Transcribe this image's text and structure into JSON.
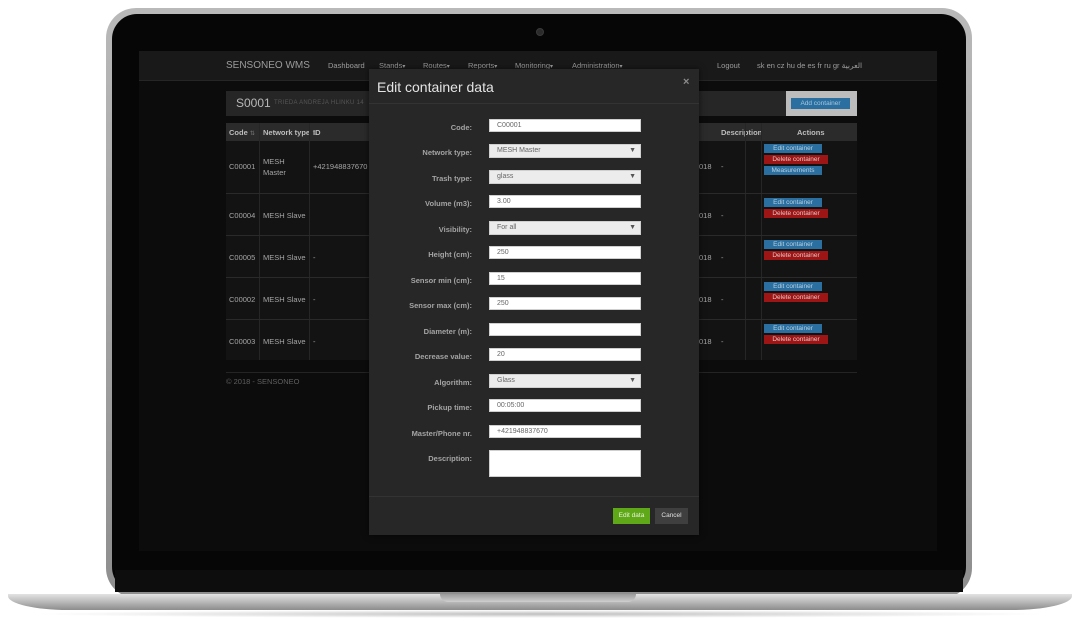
{
  "app": {
    "brand": "SENSONEO WMS"
  },
  "nav": {
    "items": [
      "Dashboard",
      "Stands",
      "Routes",
      "Reports",
      "Monitoring",
      "Administration"
    ],
    "logout": "Logout",
    "languages": "sk en cz hu de es fr ru gr العربية"
  },
  "station": {
    "code": "S0001",
    "address": "TRIEDA ANDREJA HLINKU 14"
  },
  "add_container": "Add container",
  "table": {
    "headers": {
      "code": "Code",
      "network_type": "Network type",
      "id": "ID",
      "description": "Description",
      "actions": "Actions"
    },
    "rows": [
      {
        "code": "C00001",
        "network": "MESH Master",
        "id": "+421948837670",
        "date": "018",
        "description": "-"
      },
      {
        "code": "C00004",
        "network": "MESH Slave",
        "id": "",
        "date": "018",
        "description": "-"
      },
      {
        "code": "C00005",
        "network": "MESH Slave",
        "id": "-",
        "date": "018",
        "description": "-"
      },
      {
        "code": "C00002",
        "network": "MESH Slave",
        "id": "-",
        "date": "018",
        "description": "-"
      },
      {
        "code": "C00003",
        "network": "MESH Slave",
        "id": "-",
        "date": "018",
        "description": "-"
      }
    ],
    "actions": {
      "edit": "Edit container",
      "delete": "Delete container",
      "measurements": "Measurements"
    }
  },
  "footer": "© 2018 - SENSONEO",
  "modal": {
    "title": "Edit container data",
    "close": "×",
    "fields": {
      "code": {
        "label": "Code:",
        "value": "C00001"
      },
      "network": {
        "label": "Network type:",
        "value": "MESH Master"
      },
      "trash": {
        "label": "Trash type:",
        "value": "glass"
      },
      "volume": {
        "label": "Volume (m3):",
        "value": "3.00"
      },
      "visibility": {
        "label": "Visibility:",
        "value": "For all"
      },
      "height": {
        "label": "Height (cm):",
        "value": "250"
      },
      "sensor_min": {
        "label": "Sensor min (cm):",
        "value": "15"
      },
      "sensor_max": {
        "label": "Sensor max (cm):",
        "value": "250"
      },
      "diameter": {
        "label": "Diameter (m):",
        "value": ""
      },
      "decrease": {
        "label": "Decrease value:",
        "value": "20"
      },
      "algorithm": {
        "label": "Algorithm:",
        "value": "Glass"
      },
      "pickup": {
        "label": "Pickup time:",
        "value": "00:05:00"
      },
      "master": {
        "label": "Master/Phone nr.",
        "value": "+421948837670"
      },
      "description": {
        "label": "Description:",
        "value": ""
      }
    },
    "save": "Edit data",
    "cancel": "Cancel"
  },
  "colors": {
    "save": "#5fa818",
    "delete": "#9e1515",
    "edit": "#2a6f9f",
    "modal_bg": "#272727",
    "screen_bg": "#0c0c0c"
  }
}
